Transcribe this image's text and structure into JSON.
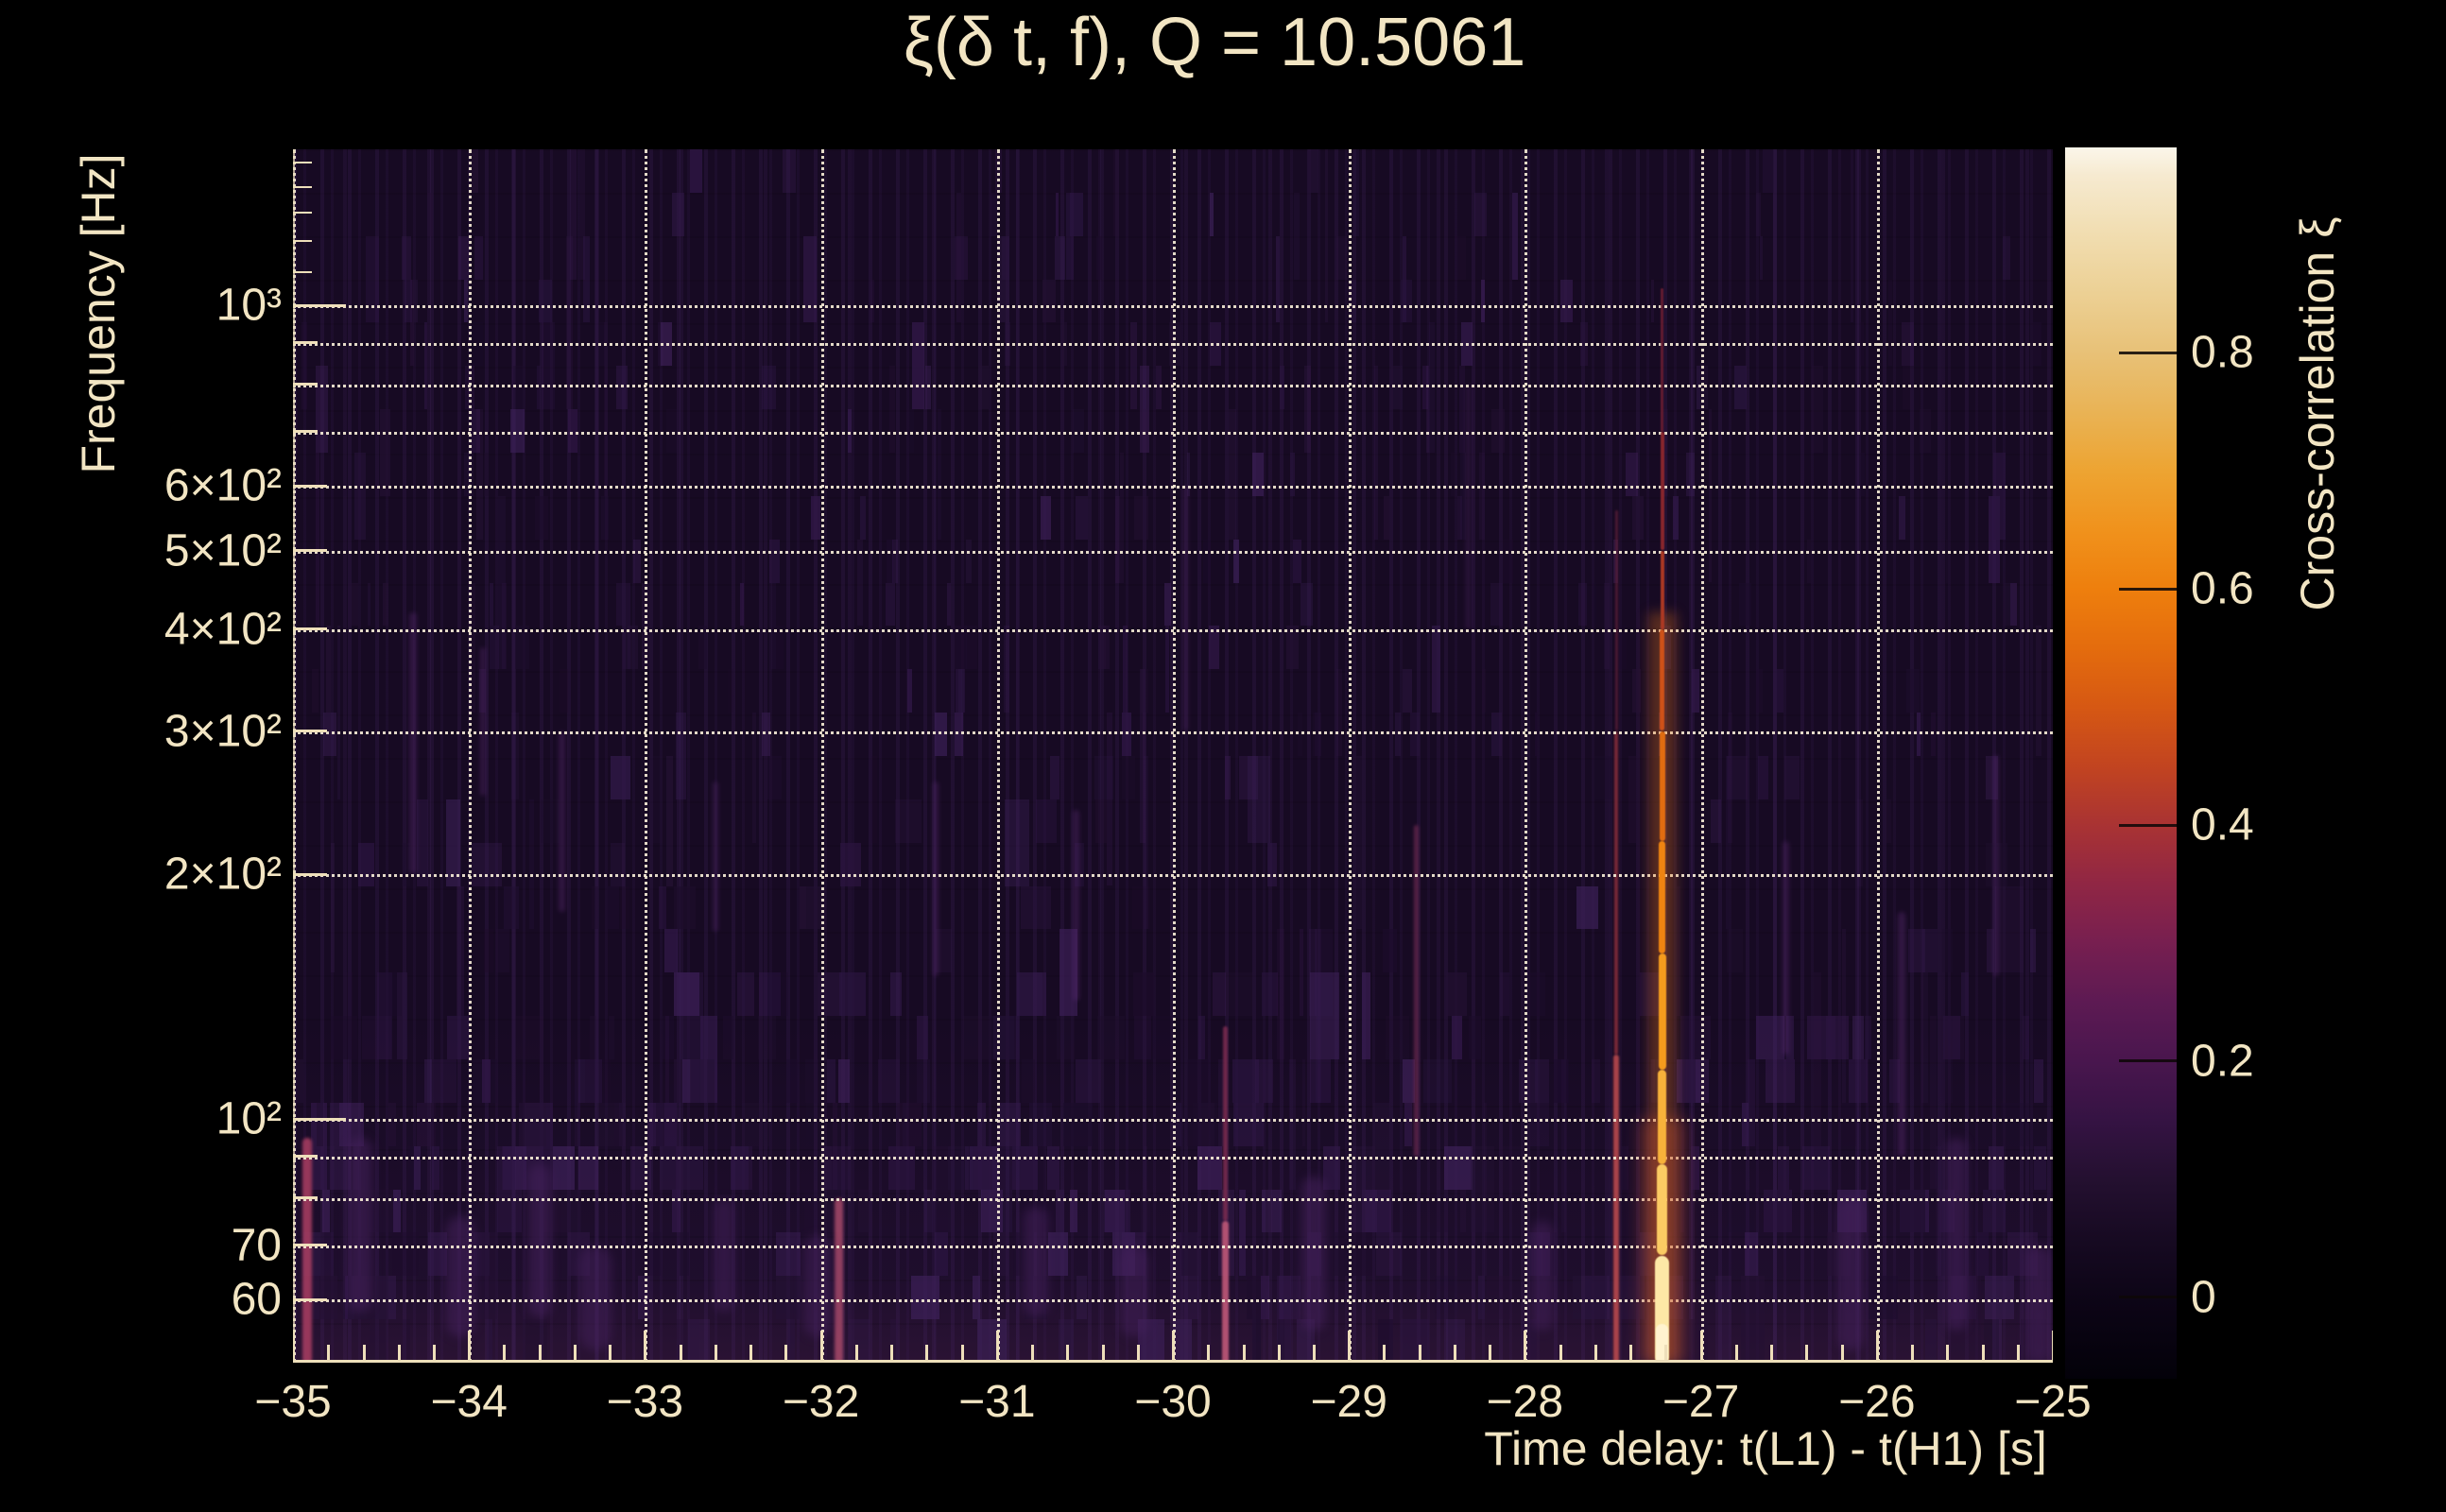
{
  "figure": {
    "title": "ξ(δ t, f), Q = 10.5061",
    "text_color": "#f2e5c3",
    "background": "#000000"
  },
  "chart_data": {
    "type": "heatmap",
    "title": "ξ(δ t, f), Q = 10.5061",
    "xlabel": "Time delay: t(L1) - t(H1) [s]",
    "ylabel": "Frequency [Hz]",
    "x_range": [
      -35,
      -25
    ],
    "x_major_ticks": [
      -35,
      -34,
      -33,
      -32,
      -31,
      -30,
      -29,
      -28,
      -27,
      -26,
      -25
    ],
    "x_tick_labels": [
      "−35",
      "−34",
      "−33",
      "−32",
      "−31",
      "−30",
      "−29",
      "−28",
      "−27",
      "−26",
      "−25"
    ],
    "x_minor_step": 0.2,
    "y_scale": "log",
    "y_range_hz": [
      50.2,
      1556
    ],
    "y_labeled_ticks": [
      {
        "f": 1000,
        "label": "10³"
      },
      {
        "f": 600,
        "label": "6×10²"
      },
      {
        "f": 500,
        "label": "5×10²"
      },
      {
        "f": 400,
        "label": "4×10²"
      },
      {
        "f": 300,
        "label": "3×10²"
      },
      {
        "f": 200,
        "label": "2×10²"
      },
      {
        "f": 100,
        "label": "10²"
      },
      {
        "f": 70,
        "label": "70"
      },
      {
        "f": 60,
        "label": "60"
      }
    ],
    "y_grid_hz": [
      1000,
      900,
      800,
      700,
      600,
      500,
      400,
      300,
      200,
      100,
      90,
      80,
      70,
      60
    ],
    "y_minor_ticks_hz": [
      1500,
      1400,
      1300,
      1200,
      1100
    ],
    "grid": true,
    "heatmap_base_color": "#170a23",
    "colorbar": {
      "label": "Cross-correlation ξ",
      "range": [
        -0.069,
        0.974
      ],
      "ticks": [
        {
          "v": 0.8,
          "label": "0.8"
        },
        {
          "v": 0.6,
          "label": "0.6"
        },
        {
          "v": 0.4,
          "label": "0.4"
        },
        {
          "v": 0.2,
          "label": "0.2"
        },
        {
          "v": 0.0,
          "label": "0"
        }
      ],
      "gradient_stops": [
        {
          "v": -0.069,
          "c": "#030109"
        },
        {
          "v": 0.0,
          "c": "#0d0517"
        },
        {
          "v": 0.05,
          "c": "#170a22"
        },
        {
          "v": 0.1,
          "c": "#241030"
        },
        {
          "v": 0.15,
          "c": "#351343"
        },
        {
          "v": 0.2,
          "c": "#49164e"
        },
        {
          "v": 0.25,
          "c": "#5d1a53"
        },
        {
          "v": 0.3,
          "c": "#771f50"
        },
        {
          "v": 0.35,
          "c": "#902644"
        },
        {
          "v": 0.4,
          "c": "#a93333"
        },
        {
          "v": 0.45,
          "c": "#c24420"
        },
        {
          "v": 0.5,
          "c": "#d65813"
        },
        {
          "v": 0.55,
          "c": "#e46c0d"
        },
        {
          "v": 0.6,
          "c": "#ee7f0d"
        },
        {
          "v": 0.65,
          "c": "#f0921c"
        },
        {
          "v": 0.7,
          "c": "#eda432"
        },
        {
          "v": 0.75,
          "c": "#e9b355"
        },
        {
          "v": 0.8,
          "c": "#e8c177"
        },
        {
          "v": 0.85,
          "c": "#ecd094"
        },
        {
          "v": 0.9,
          "c": "#f1ddb0"
        },
        {
          "v": 0.95,
          "c": "#f6ead0"
        },
        {
          "v": 0.974,
          "c": "#fbf6ea"
        }
      ]
    },
    "signal": {
      "time_delay_s": -27.22,
      "peak_value": 0.97,
      "freq_span_hz": [
        50,
        1050
      ],
      "glow": [
        {
          "f0": 420,
          "f1": 50,
          "w": 30,
          "c": "rgba(235,120,25,0.30)",
          "blur": 6
        },
        {
          "f0": 100,
          "f1": 50,
          "w": 48,
          "c": "rgba(205,85,45,0.35)",
          "blur": 8
        }
      ],
      "segments": [
        {
          "f0": 1050,
          "f1": 700,
          "w": 3,
          "c": "#6e1f33",
          "o": 0.85
        },
        {
          "f0": 700,
          "f1": 500,
          "w": 4,
          "c": "#93282e",
          "o": 0.9
        },
        {
          "f0": 500,
          "f1": 400,
          "w": 4,
          "c": "#b03a24",
          "o": 0.95
        },
        {
          "f0": 400,
          "f1": 300,
          "w": 5,
          "c": "#cd5118",
          "o": 1
        },
        {
          "f0": 300,
          "f1": 220,
          "w": 6,
          "c": "#e06c10",
          "o": 1
        },
        {
          "f0": 220,
          "f1": 160,
          "w": 7,
          "c": "#ee8411",
          "o": 1
        },
        {
          "f0": 160,
          "f1": 115,
          "w": 8,
          "c": "#f49b1d",
          "o": 1
        },
        {
          "f0": 115,
          "f1": 88,
          "w": 9,
          "c": "#f7b13a",
          "o": 1
        },
        {
          "f0": 88,
          "f1": 68,
          "w": 11,
          "c": "#fbcb63",
          "o": 1
        },
        {
          "f0": 68,
          "f1": 50,
          "w": 15,
          "c": "#fde8a6",
          "o": 1
        },
        {
          "f0": 56,
          "f1": 50,
          "w": 13,
          "c": "#fff3cf",
          "o": 1
        }
      ]
    },
    "secondary_features": [
      {
        "t": -27.48,
        "f0": 560,
        "f1": 300,
        "w": 3,
        "c": "#5a1e38",
        "o": 0.8,
        "blur": 1
      },
      {
        "t": -27.48,
        "f0": 300,
        "f1": 120,
        "w": 4,
        "c": "#8c2f3c",
        "o": 0.85,
        "blur": 1
      },
      {
        "t": -27.48,
        "f0": 120,
        "f1": 50,
        "w": 6,
        "c": "#b8494e",
        "o": 0.9,
        "blur": 1
      },
      {
        "t": -29.7,
        "f0": 130,
        "f1": 75,
        "w": 5,
        "c": "#7c2c50",
        "o": 0.85,
        "blur": 1
      },
      {
        "t": -29.7,
        "f0": 75,
        "f1": 50,
        "w": 7,
        "c": "#c05878",
        "o": 0.9,
        "blur": 1
      },
      {
        "t": -28.62,
        "f0": 230,
        "f1": 90,
        "w": 5,
        "c": "#6a2950",
        "o": 0.75,
        "blur": 1.5
      },
      {
        "t": -31.9,
        "f0": 80,
        "f1": 50,
        "w": 9,
        "c": "#a84a6a",
        "o": 0.85,
        "blur": 1.5
      },
      {
        "t": -34.92,
        "f0": 95,
        "f1": 50,
        "w": 10,
        "c": "#a43c60",
        "o": 0.9,
        "blur": 1.5
      },
      {
        "t": -34.32,
        "f0": 420,
        "f1": 200,
        "w": 8,
        "c": "#5a2b72",
        "o": 0.38,
        "blur": 2.5
      },
      {
        "t": -33.92,
        "f0": 380,
        "f1": 250,
        "w": 6,
        "c": "#5a2b72",
        "o": 0.38,
        "blur": 2.5
      },
      {
        "t": -33.47,
        "f0": 300,
        "f1": 180,
        "w": 7,
        "c": "#5a2b72",
        "o": 0.38,
        "blur": 2.5
      },
      {
        "t": -32.6,
        "f0": 260,
        "f1": 170,
        "w": 6,
        "c": "#5a2b72",
        "o": 0.35,
        "blur": 2.5
      },
      {
        "t": -31.35,
        "f0": 260,
        "f1": 150,
        "w": 6,
        "c": "#5a2b72",
        "o": 0.38,
        "blur": 2.5
      },
      {
        "t": -30.55,
        "f0": 240,
        "f1": 140,
        "w": 7,
        "c": "#5a2b72",
        "o": 0.38,
        "blur": 2.5
      },
      {
        "t": -29.93,
        "f0": 600,
        "f1": 300,
        "w": 5,
        "c": "#5a2b72",
        "o": 0.32,
        "blur": 2.5
      },
      {
        "t": -28.32,
        "f0": 800,
        "f1": 400,
        "w": 5,
        "c": "#5a2b72",
        "o": 0.3,
        "blur": 2.5
      },
      {
        "t": -26.52,
        "f0": 220,
        "f1": 120,
        "w": 7,
        "c": "#5a2b72",
        "o": 0.38,
        "blur": 2.5
      },
      {
        "t": -25.86,
        "f0": 180,
        "f1": 90,
        "w": 8,
        "c": "#5a2b72",
        "o": 0.4,
        "blur": 2.5
      },
      {
        "t": -25.32,
        "f0": 280,
        "f1": 150,
        "w": 6,
        "c": "#5a2b72",
        "o": 0.35,
        "blur": 2.5
      },
      {
        "t": -34.62,
        "f0": 95,
        "f1": 58,
        "w": 26,
        "c": "#45215c",
        "o": 0.55,
        "blur": 5
      },
      {
        "t": -34.05,
        "f0": 76,
        "f1": 54,
        "w": 30,
        "c": "#45215c",
        "o": 0.55,
        "blur": 5
      },
      {
        "t": -33.6,
        "f0": 88,
        "f1": 57,
        "w": 24,
        "c": "#45215c",
        "o": 0.55,
        "blur": 5
      },
      {
        "t": -33.28,
        "f0": 70,
        "f1": 52,
        "w": 34,
        "c": "#45215c",
        "o": 0.5,
        "blur": 5
      },
      {
        "t": -32.55,
        "f0": 80,
        "f1": 58,
        "w": 22,
        "c": "#45215c",
        "o": 0.5,
        "blur": 5
      },
      {
        "t": -32.02,
        "f0": 72,
        "f1": 54,
        "w": 30,
        "c": "#45215c",
        "o": 0.5,
        "blur": 5
      },
      {
        "t": -30.78,
        "f0": 78,
        "f1": 57,
        "w": 26,
        "c": "#45215c",
        "o": 0.5,
        "blur": 5
      },
      {
        "t": -30.22,
        "f0": 70,
        "f1": 54,
        "w": 30,
        "c": "#45215c",
        "o": 0.5,
        "blur": 5
      },
      {
        "t": -29.2,
        "f0": 85,
        "f1": 55,
        "w": 26,
        "c": "#45215c",
        "o": 0.55,
        "blur": 5
      },
      {
        "t": -27.9,
        "f0": 75,
        "f1": 55,
        "w": 24,
        "c": "#45215c",
        "o": 0.5,
        "blur": 5
      },
      {
        "t": -26.15,
        "f0": 80,
        "f1": 52,
        "w": 28,
        "c": "#45215c",
        "o": 0.55,
        "blur": 5
      },
      {
        "t": -25.55,
        "f0": 95,
        "f1": 55,
        "w": 22,
        "c": "#45215c",
        "o": 0.55,
        "blur": 5
      },
      {
        "t": -25.08,
        "f0": 70,
        "f1": 50,
        "w": 26,
        "c": "#45215c",
        "o": 0.55,
        "blur": 5
      }
    ]
  }
}
